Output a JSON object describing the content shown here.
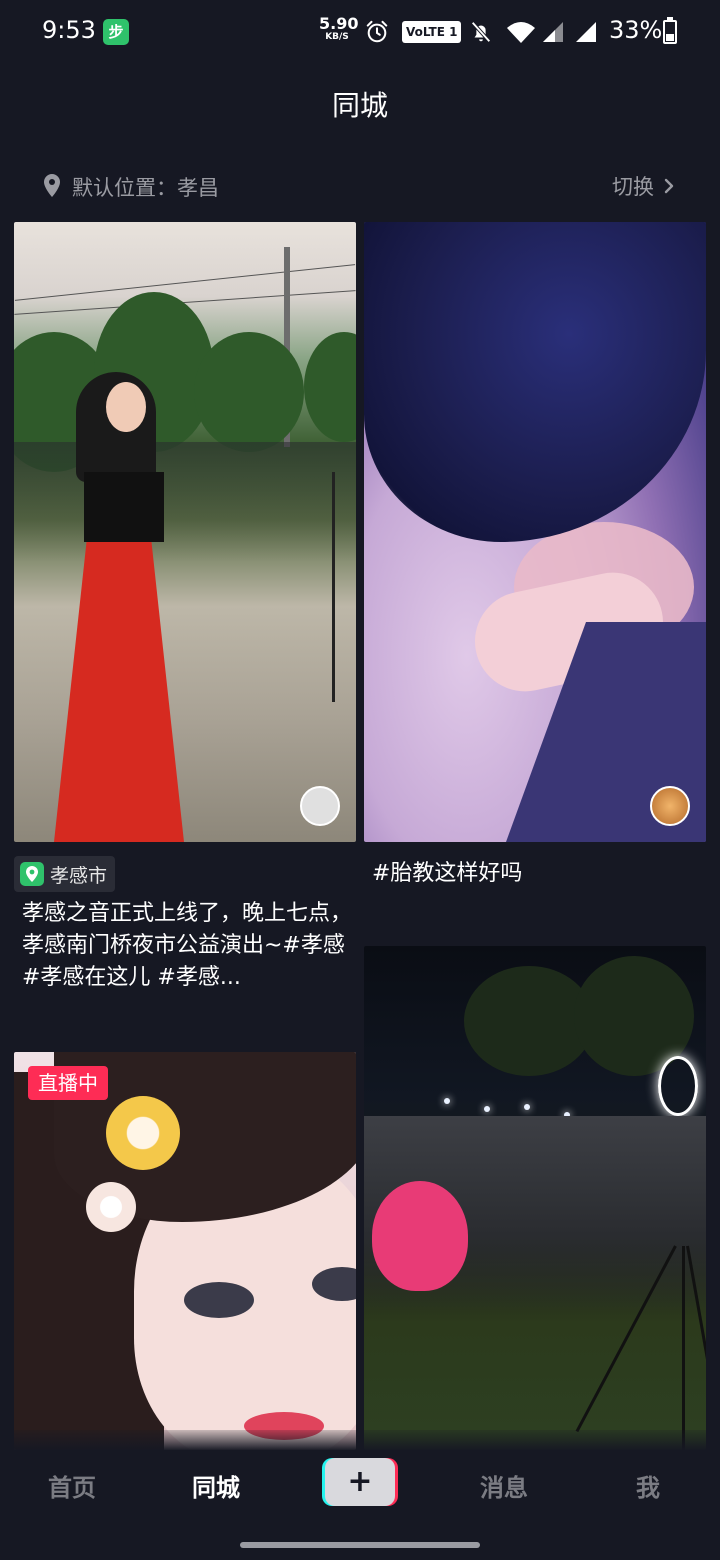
{
  "status_bar": {
    "time": "9:53",
    "app_icon_glyph": "步",
    "network_speed_value": "5.90",
    "network_speed_unit": "KB/S",
    "volte": "VoLTE 1",
    "battery": "33%",
    "battery_level": 0.33,
    "icons": [
      "alarm-icon",
      "notifications-off-icon",
      "wifi-icon",
      "signal-icon",
      "signal-icon",
      "battery-icon"
    ]
  },
  "header": {
    "title": "同城"
  },
  "location": {
    "label": "默认位置：孝昌",
    "switch_label": "切换"
  },
  "feed": {
    "cards": [
      {
        "location_tag": "孝感市",
        "description": "孝感之音正式上线了，晚上七点，孝感南门桥夜市公益演出~#孝感 #孝感在这儿 #孝感..."
      },
      {
        "description": "#胎教这样好吗"
      },
      {
        "live_badge": "直播中"
      },
      {}
    ]
  },
  "bottom_nav": {
    "home": "首页",
    "city": "同城",
    "messages": "消息",
    "me": "我",
    "plus": "+"
  },
  "colors": {
    "background": "#161823",
    "accent_red": "#fe2c55",
    "accent_cyan": "#25f4ee",
    "muted_text": "#9a9ba2"
  }
}
